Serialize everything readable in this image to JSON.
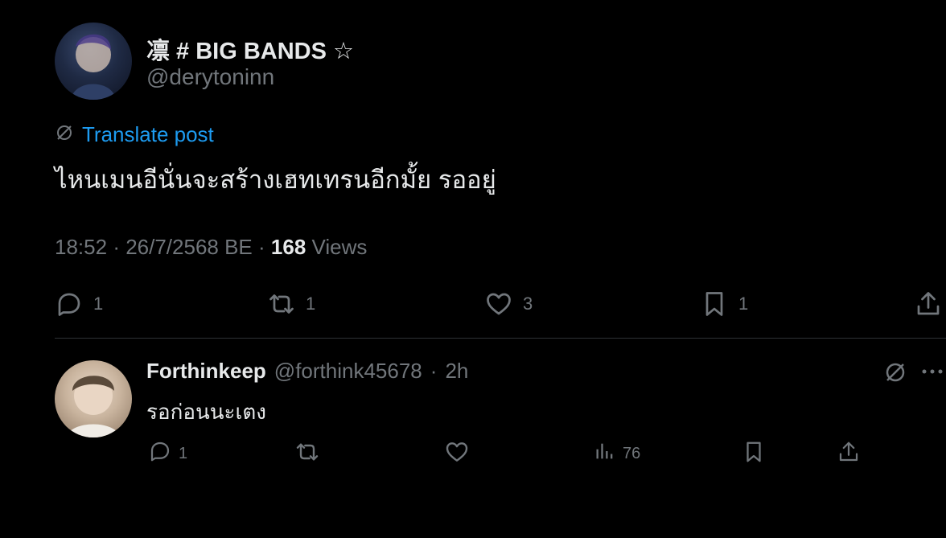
{
  "post": {
    "display_name": "凛 # BIG BANDS ☆",
    "handle": "@derytoninn",
    "translate_label": "Translate post",
    "text": "ไหนเมนอีนั่นจะสร้างเฮทเทรนอีกมั้ย รออยู่",
    "time": "18:52",
    "date": "26/7/2568 BE",
    "views_count": "168",
    "views_label": "Views",
    "actions": {
      "reply_count": "1",
      "repost_count": "1",
      "like_count": "3",
      "bookmark_count": "1"
    }
  },
  "reply": {
    "display_name": "Forthinkeep",
    "handle": "@forthink45678",
    "time": "2h",
    "text": "รอก่อนนะเตง",
    "actions": {
      "reply_count": "1",
      "views_count": "76"
    }
  },
  "colors": {
    "background": "#000000",
    "text_primary": "#e7e9ea",
    "text_secondary": "#71767b",
    "accent": "#1d9bf0",
    "divider": "#2f3336"
  },
  "icons": {
    "translate": "globe-slash-icon",
    "reply": "speech-bubble-icon",
    "repost": "repost-icon",
    "like": "heart-icon",
    "bookmark": "bookmark-icon",
    "share": "share-icon",
    "views": "bar-chart-icon",
    "more": "more-icon"
  }
}
